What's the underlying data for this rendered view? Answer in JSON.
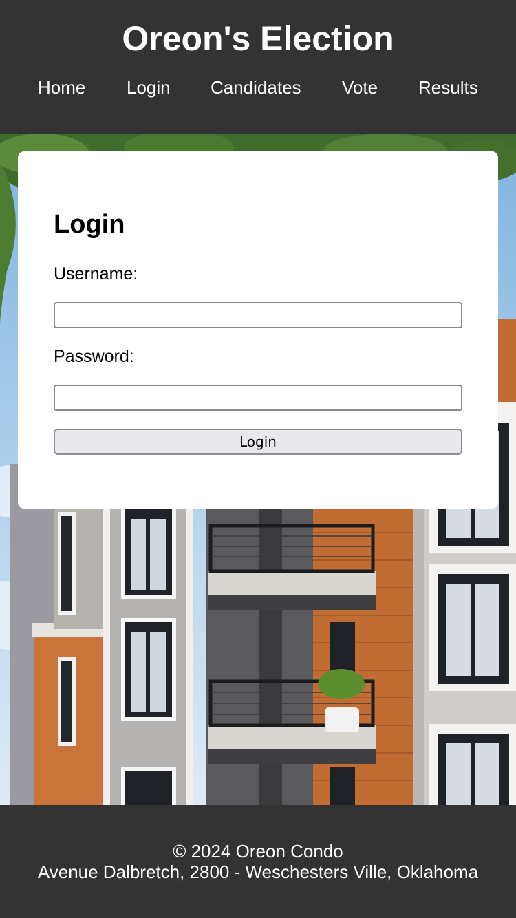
{
  "header": {
    "title": "Oreon's Election",
    "nav": [
      "Home",
      "Login",
      "Candidates",
      "Vote",
      "Results"
    ]
  },
  "login": {
    "title": "Login",
    "username_label": "Username:",
    "username_value": "",
    "password_label": "Password:",
    "password_value": "",
    "submit_label": "Login"
  },
  "footer": {
    "copyright": "© 2024 Oreon Condo",
    "address": "Avenue Dalbretch, 2800 - Weschesters Ville, Oklahoma"
  },
  "colors": {
    "header_bg": "#333333",
    "footer_bg": "#333333",
    "card_bg": "#ffffff",
    "button_bg": "#e8e8ed"
  }
}
